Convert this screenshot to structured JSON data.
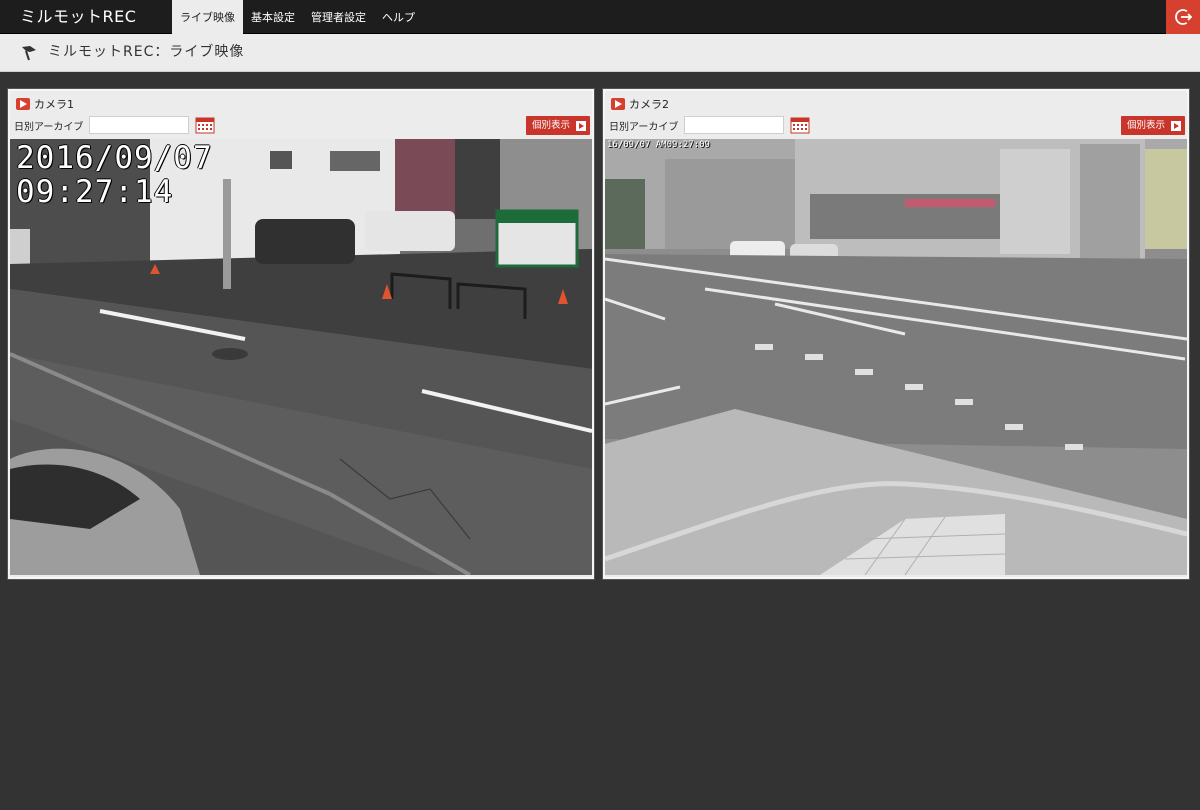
{
  "app": {
    "brand": "ミルモットREC"
  },
  "nav": {
    "items": [
      {
        "label": "ライブ映像",
        "active": true
      },
      {
        "label": "基本設定",
        "active": false
      },
      {
        "label": "管理者設定",
        "active": false
      },
      {
        "label": "ヘルプ",
        "active": false
      }
    ]
  },
  "page": {
    "title": "ミルモットREC：ライブ映像"
  },
  "cameras": [
    {
      "name": "カメラ1",
      "archive_label": "日別アーカイブ",
      "archive_value": "",
      "single_view_label": "個別表示",
      "timestamp_date": "2016/09/07",
      "timestamp_time": "09:27:14"
    },
    {
      "name": "カメラ2",
      "archive_label": "日別アーカイブ",
      "archive_value": "",
      "single_view_label": "個別表示",
      "timestamp": "16/09/07 AM09:27:09"
    }
  ],
  "colors": {
    "accent": "#d6402f",
    "nav_bg": "#1d1d1d",
    "page_bg": "#333333",
    "panel_bg": "#ececec"
  },
  "icons": {
    "logout": "logout-icon",
    "title": "flag-icon",
    "camera": "video-play-icon",
    "calendar": "calendar-icon",
    "single_view": "play-arrow-icon"
  }
}
